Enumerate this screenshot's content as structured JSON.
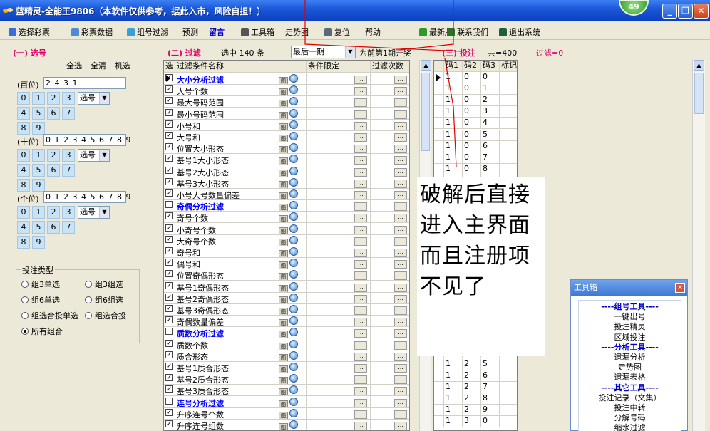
{
  "window": {
    "title": "蓝精灵-全能王9806（本软件仅供参考，据此入市，风险自担！）",
    "badge": "49",
    "min": "_",
    "max": "❐",
    "close": "✕"
  },
  "toolbar": {
    "items": [
      {
        "label": "选择彩票",
        "icon_color": "#3a6fd6"
      },
      {
        "label": "彩票数据",
        "icon_color": "#4f8ad6"
      },
      {
        "label": "组号过滤",
        "icon_color": "#3aa0d6"
      },
      {
        "label": "预测",
        "icon_color": ""
      },
      {
        "label": "留言",
        "icon_color": ""
      },
      {
        "label": "工具箱",
        "icon_color": "#555555"
      },
      {
        "label": "走势图",
        "icon_color": ""
      },
      {
        "label": "复位",
        "icon_color": "#5a6a7a"
      },
      {
        "label": "帮助",
        "icon_color": ""
      },
      {
        "label": "最新版",
        "icon_color": "#2f9a2a"
      },
      {
        "label": "联系我们",
        "icon_color": "#2f6f2a"
      },
      {
        "label": "退出系统",
        "icon_color": "#1f5f3f"
      }
    ]
  },
  "left": {
    "title": "(一) 选号",
    "links": [
      "全选",
      "全清",
      "机选"
    ],
    "positions": [
      {
        "label": "(百位)",
        "digits": "2 4 3 1"
      },
      {
        "label": "(十位)",
        "digits": "0 1 2 3 4 5 6 7 8 9"
      },
      {
        "label": "(个位)",
        "digits": "0 1 2 3 4 5 6 7 8 9"
      }
    ],
    "num_buttons": [
      "0",
      "1",
      "2",
      "3",
      "4",
      "5",
      "6",
      "7",
      "8",
      "9"
    ],
    "select_label": "选号",
    "bet": {
      "legend": "投注类型",
      "options": [
        "组3单选",
        "组3组选",
        "组6单选",
        "组6组选",
        "组选合投单选",
        "组选合投",
        "所有组合"
      ],
      "selected": "所有组合"
    }
  },
  "mid": {
    "title": "(二) 过滤",
    "selected_info": "选中 140 条",
    "period": "最后一期",
    "period_note": "为前第1期开奖",
    "columns": [
      "选",
      "过滤条件名称",
      "条件限定",
      "过滤次数"
    ],
    "rows": [
      {
        "name": "大小分析过滤",
        "checked": true,
        "section": true
      },
      {
        "name": "大号个数",
        "checked": true,
        "section": false
      },
      {
        "name": "最大号码范围",
        "checked": true,
        "section": false
      },
      {
        "name": "最小号码范围",
        "checked": true,
        "section": false
      },
      {
        "name": "小号和",
        "checked": true,
        "section": false
      },
      {
        "name": "大号和",
        "checked": true,
        "section": false
      },
      {
        "name": "位置大小形态",
        "checked": true,
        "section": false
      },
      {
        "name": "基号1大小形态",
        "checked": true,
        "section": false
      },
      {
        "name": "基号2大小形态",
        "checked": true,
        "section": false
      },
      {
        "name": "基号3大小形态",
        "checked": true,
        "section": false
      },
      {
        "name": "小号大号数量偏差",
        "checked": true,
        "section": false
      },
      {
        "name": "奇偶分析过滤",
        "checked": false,
        "section": true
      },
      {
        "name": "奇号个数",
        "checked": true,
        "section": false
      },
      {
        "name": "小奇号个数",
        "checked": true,
        "section": false
      },
      {
        "name": "大奇号个数",
        "checked": true,
        "section": false
      },
      {
        "name": "奇号和",
        "checked": true,
        "section": false
      },
      {
        "name": "偶号和",
        "checked": true,
        "section": false
      },
      {
        "name": "位置奇偶形态",
        "checked": true,
        "section": false
      },
      {
        "name": "基号1奇偶形态",
        "checked": true,
        "section": false
      },
      {
        "name": "基号2奇偶形态",
        "checked": true,
        "section": false
      },
      {
        "name": "基号3奇偶形态",
        "checked": true,
        "section": false
      },
      {
        "name": "奇偶数量偏差",
        "checked": true,
        "section": false
      },
      {
        "name": "质数分析过滤",
        "checked": false,
        "section": true
      },
      {
        "name": "质数个数",
        "checked": true,
        "section": false
      },
      {
        "name": "质合形态",
        "checked": true,
        "section": false
      },
      {
        "name": "基号1质合形态",
        "checked": true,
        "section": false
      },
      {
        "name": "基号2质合形态",
        "checked": true,
        "section": false
      },
      {
        "name": "基号3质合形态",
        "checked": true,
        "section": false
      },
      {
        "name": "连号分析过滤",
        "checked": false,
        "section": true
      },
      {
        "name": "升序连号个数",
        "checked": true,
        "section": false
      },
      {
        "name": "升序连号组数",
        "checked": true,
        "section": false
      }
    ],
    "btn_tu": "图",
    "btn_dots": "..."
  },
  "right": {
    "title": "(三) 投注",
    "total": "共=400",
    "filter_info": "过滤=0",
    "columns": [
      "码1",
      "码2",
      "码3",
      "标记"
    ],
    "rows": [
      [
        "1",
        "0",
        "0"
      ],
      [
        "1",
        "0",
        "1"
      ],
      [
        "1",
        "0",
        "2"
      ],
      [
        "1",
        "0",
        "3"
      ],
      [
        "1",
        "0",
        "4"
      ],
      [
        "1",
        "0",
        "5"
      ],
      [
        "1",
        "0",
        "6"
      ],
      [
        "1",
        "0",
        "7"
      ],
      [
        "1",
        "0",
        "8"
      ],
      [
        "",
        "",
        ""
      ],
      [
        "",
        "",
        ""
      ],
      [
        "",
        "",
        ""
      ],
      [
        "",
        "",
        ""
      ],
      [
        "",
        "",
        ""
      ],
      [
        "",
        "",
        ""
      ],
      [
        "",
        "",
        ""
      ],
      [
        "",
        "",
        ""
      ],
      [
        "",
        "",
        ""
      ],
      [
        "",
        "",
        ""
      ],
      [
        "",
        "",
        ""
      ],
      [
        "",
        "",
        ""
      ],
      [
        "",
        "",
        ""
      ],
      [
        "",
        "",
        ""
      ],
      [
        "",
        "",
        ""
      ],
      [
        "1",
        "2",
        "4"
      ],
      [
        "1",
        "2",
        "5"
      ],
      [
        "1",
        "2",
        "6"
      ],
      [
        "1",
        "2",
        "7"
      ],
      [
        "1",
        "2",
        "8"
      ],
      [
        "1",
        "2",
        "9"
      ],
      [
        "1",
        "3",
        "0"
      ]
    ]
  },
  "overlay": {
    "text": "破解后直接进入主界面而且注册项不见了"
  },
  "toolbox": {
    "title": "工具箱",
    "items": [
      {
        "text": "----组号工具----",
        "section": true
      },
      {
        "text": "一键出号",
        "section": false
      },
      {
        "text": "投注精灵",
        "section": false
      },
      {
        "text": "区域投注",
        "section": false
      },
      {
        "text": "----分析工具----",
        "section": true
      },
      {
        "text": "遗漏分析",
        "section": false
      },
      {
        "text": "走势图",
        "section": false
      },
      {
        "text": "遗漏表格",
        "section": false
      },
      {
        "text": "----其它工具----",
        "section": true
      },
      {
        "text": "投注记录（文集）",
        "section": false
      },
      {
        "text": "投注中转",
        "section": false
      },
      {
        "text": "分解号码",
        "section": false
      },
      {
        "text": "缩水过滤",
        "section": false
      }
    ]
  },
  "colors": {
    "accent": "#e0006a",
    "blue_text": "#0000ff",
    "title_bar": "#1a56d8",
    "annotation": "#e00000"
  }
}
